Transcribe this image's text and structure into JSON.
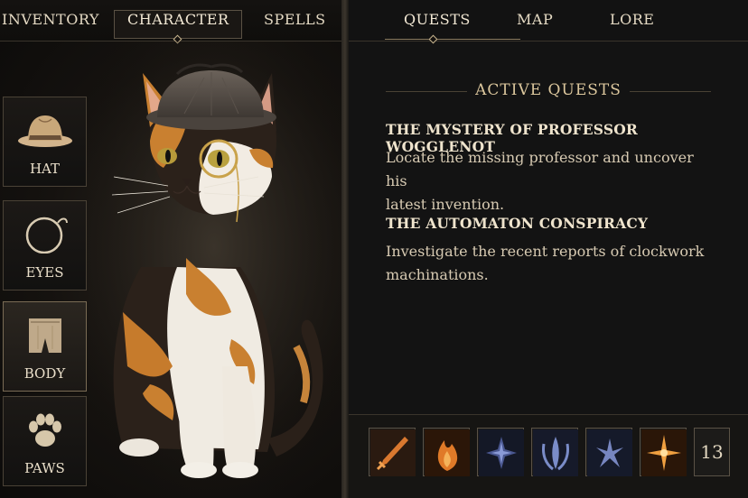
{
  "left_tabs": [
    {
      "label": "INVENTORY"
    },
    {
      "label": "CHARACTER"
    },
    {
      "label": "SPELLS"
    }
  ],
  "slots": [
    {
      "label": "HAT",
      "icon": "hat-icon"
    },
    {
      "label": "EYES",
      "icon": "monocle-icon"
    },
    {
      "label": "BODY",
      "icon": "vest-icon"
    },
    {
      "label": "PAWS",
      "icon": "paw-icon"
    }
  ],
  "character": {
    "portrait": "calico-cat-detective"
  },
  "right_tabs": [
    {
      "label": "QUESTS"
    },
    {
      "label": "MAP"
    },
    {
      "label": "LORE"
    }
  ],
  "quests": {
    "header": "ACTIVE QUESTS",
    "items": [
      {
        "title": "THE MYSTERY OF PROFESSOR WOGGLENOT",
        "desc_line1": "Locate the missing professor and uncover his",
        "desc_line2": "latest invention."
      },
      {
        "title": "THE AUTOMATON CONSPIRACY",
        "desc_line1": "Investigate the recent reports of clockwork",
        "desc_line2": "machinations."
      }
    ]
  },
  "hotbar": {
    "items": [
      {
        "icon": "dagger-icon",
        "color": "#d9782f"
      },
      {
        "icon": "flame-icon",
        "color": "#e07a28"
      },
      {
        "icon": "compass-star-icon",
        "color": "#6a7bb8"
      },
      {
        "icon": "trident-rune-icon",
        "color": "#7a8cc8"
      },
      {
        "icon": "shuriken-icon",
        "color": "#7786c0"
      },
      {
        "icon": "sparkle-star-icon",
        "color": "#f0a040"
      }
    ],
    "count": "13"
  }
}
